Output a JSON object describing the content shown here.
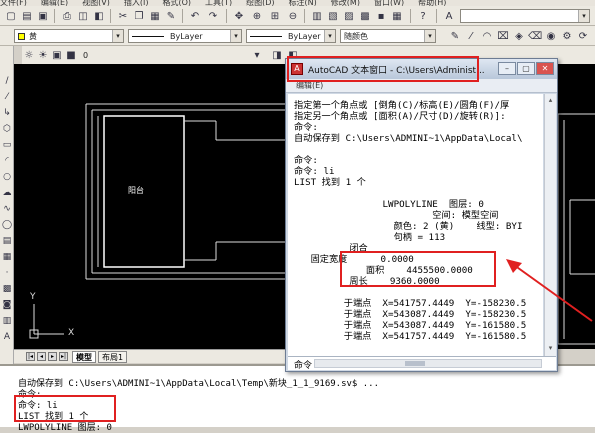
{
  "menubar": [
    "文件(F)",
    "编辑(E)",
    "视图(V)",
    "插入(I)",
    "格式(O)",
    "工具(T)",
    "绘图(D)",
    "标注(N)",
    "修改(M)",
    "窗口(W)",
    "帮助(H)"
  ],
  "toolbar": {
    "layer_combo": "黄",
    "linetype_combo": "ByLayer",
    "lineweight_combo": "ByLayer",
    "color_combo": "随颜色",
    "layer_state": "0"
  },
  "canvas": {
    "room_label": "阳台",
    "axis_y": "Y",
    "axis_x": "X",
    "tabs": [
      "模型",
      "布局1"
    ]
  },
  "text_window": {
    "title": "AutoCAD 文本窗口 - C:\\Users\\Administ...",
    "menu": "编辑(E)",
    "lines": [
      "指定第一个角点或 [倒角(C)/标高(E)/圆角(F)/厚",
      "指定另一个角点或 [面积(A)/尺寸(D)/旋转(R)]:",
      "命令:",
      "自动保存到 C:\\Users\\ADMINI~1\\AppData\\Local\\",
      "",
      "命令:",
      "命令: li",
      "LIST 找到 1 个",
      "",
      "                LWPOLYLINE  图层: 0",
      "                         空间: 模型空间",
      "                  颜色: 2 (黄)    线型: BYI",
      "                  句柄 = 113",
      "          闭合",
      "   固定宽度      0.0000",
      "             面积    4455500.0000",
      "          周长    9360.0000",
      "",
      "         于端点  X=541757.4449  Y=-158230.5",
      "         于端点  X=543087.4449  Y=-158230.5",
      "         于端点  X=543087.4449  Y=-161580.5",
      "         于端点  X=541757.4449  Y=-161580.5"
    ],
    "prompt": "命令:"
  },
  "command_area": {
    "lines": [
      "自动保存到 C:\\Users\\ADMINI~1\\AppData\\Local\\Temp\\新块_1_1_9169.sv$ ...",
      "命令:",
      "命令: li",
      "LIST 找到 1 个",
      "                    LWPOLYLINE  图层: 0"
    ]
  },
  "colors": {
    "highlight_red": "#e02020",
    "canvas_bg": "#000000",
    "drawing_line": "#ffffff"
  }
}
